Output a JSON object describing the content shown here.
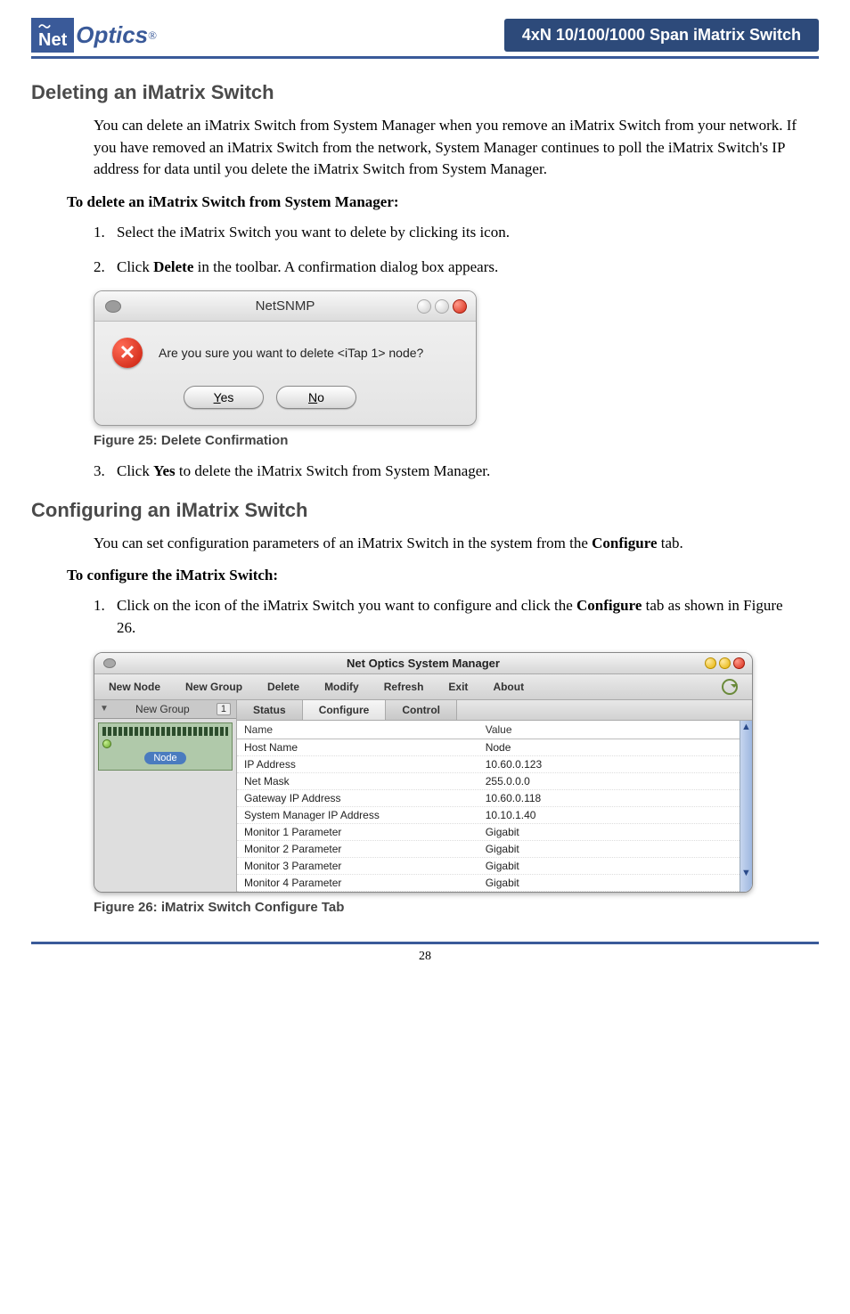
{
  "header": {
    "logo_net": "Net",
    "logo_optics": "Optics",
    "logo_reg": "®",
    "product_title": "4xN 10/100/1000 Span iMatrix Switch"
  },
  "section1": {
    "heading": "Deleting an iMatrix Switch",
    "intro": "You can delete an iMatrix Switch from System Manager when you remove an iMatrix Switch from your network. If you have removed an iMatrix Switch from the network, System Manager continues to poll the iMatrix Switch's IP address for data until you delete the iMatrix Switch from System Manager.",
    "subhead": "To delete an iMatrix Switch from System Manager:",
    "step1": "Select the iMatrix Switch you want to delete by clicking its icon.",
    "step2_pre": "Click ",
    "step2_b": "Delete",
    "step2_post": " in the toolbar. A confirmation dialog box appears.",
    "step3_pre": "Click ",
    "step3_b": "Yes",
    "step3_post": " to delete the iMatrix Switch from System Manager."
  },
  "dialog": {
    "title": "NetSNMP",
    "message": "Are you sure you want to delete <iTap 1> node?",
    "yes_u": "Y",
    "yes_rest": "es",
    "no_u": "N",
    "no_rest": "o"
  },
  "fig25": {
    "num": "Figure 25: ",
    "title": "Delete Confirmation"
  },
  "section2": {
    "heading": "Configuring an iMatrix Switch",
    "intro_pre": "You can set configuration parameters of an iMatrix Switch in the system from the ",
    "intro_b": "Configure",
    "intro_post": " tab.",
    "subhead": "To configure the iMatrix Switch:",
    "step1_pre": "Click on the icon of the iMatrix Switch you want to configure and click the ",
    "step1_b": "Configure",
    "step1_post": " tab as shown in Figure 26."
  },
  "winmgr": {
    "title": "Net Optics System Manager",
    "menu": {
      "new_node": "New Node",
      "new_group": "New Group",
      "delete": "Delete",
      "modify": "Modify",
      "refresh": "Refresh",
      "exit": "Exit",
      "about": "About"
    },
    "side": {
      "group_label": "New Group",
      "group_count": "1",
      "node_chip": "Node"
    },
    "tabs": {
      "status": "Status",
      "configure": "Configure",
      "control": "Control"
    },
    "colhdr": {
      "name": "Name",
      "value": "Value"
    },
    "rows": [
      {
        "name": "Host Name",
        "value": "Node"
      },
      {
        "name": "IP Address",
        "value": "10.60.0.123"
      },
      {
        "name": "Net Mask",
        "value": "255.0.0.0"
      },
      {
        "name": "Gateway IP Address",
        "value": "10.60.0.118"
      },
      {
        "name": "System Manager IP Address",
        "value": "10.10.1.40"
      },
      {
        "name": "Monitor 1 Parameter",
        "value": "Gigabit"
      },
      {
        "name": "Monitor 2 Parameter",
        "value": "Gigabit"
      },
      {
        "name": "Monitor 3 Parameter",
        "value": "Gigabit"
      },
      {
        "name": "Monitor 4 Parameter",
        "value": "Gigabit"
      }
    ]
  },
  "fig26": {
    "num": "Figure 26: ",
    "title": "iMatrix Switch Configure Tab"
  },
  "page_number": "28"
}
